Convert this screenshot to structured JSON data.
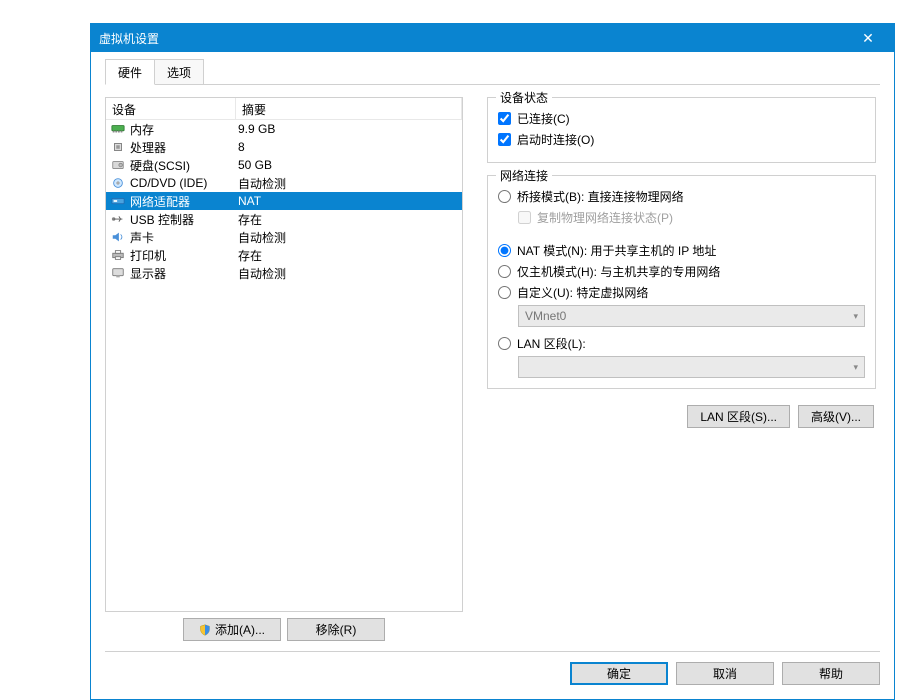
{
  "title": "虚拟机设置",
  "tabs": {
    "hardware": "硬件",
    "options": "选项"
  },
  "table": {
    "header_device": "设备",
    "header_summary": "摘要",
    "rows": [
      {
        "icon": "memory",
        "name": "内存",
        "summary": "9.9 GB"
      },
      {
        "icon": "cpu",
        "name": "处理器",
        "summary": "8"
      },
      {
        "icon": "disk",
        "name": "硬盘(SCSI)",
        "summary": "50 GB"
      },
      {
        "icon": "cd",
        "name": "CD/DVD (IDE)",
        "summary": "自动检测"
      },
      {
        "icon": "net",
        "name": "网络适配器",
        "summary": "NAT",
        "selected": true
      },
      {
        "icon": "usb",
        "name": "USB 控制器",
        "summary": "存在"
      },
      {
        "icon": "sound",
        "name": "声卡",
        "summary": "自动检测"
      },
      {
        "icon": "printer",
        "name": "打印机",
        "summary": "存在"
      },
      {
        "icon": "display",
        "name": "显示器",
        "summary": "自动检测"
      }
    ]
  },
  "buttons": {
    "add": "添加(A)...",
    "remove": "移除(R)"
  },
  "device_state": {
    "legend": "设备状态",
    "connected": "已连接(C)",
    "connect_at_poweron": "启动时连接(O)"
  },
  "net": {
    "legend": "网络连接",
    "bridged": "桥接模式(B): 直接连接物理网络",
    "replicate": "复制物理网络连接状态(P)",
    "nat": "NAT 模式(N): 用于共享主机的 IP 地址",
    "hostonly": "仅主机模式(H): 与主机共享的专用网络",
    "custom": "自定义(U): 特定虚拟网络",
    "vmnet": "VMnet0",
    "lan_segment": "LAN 区段(L):",
    "lan_segments_btn": "LAN 区段(S)...",
    "advanced_btn": "高级(V)..."
  },
  "footer": {
    "ok": "确定",
    "cancel": "取消",
    "help": "帮助"
  }
}
